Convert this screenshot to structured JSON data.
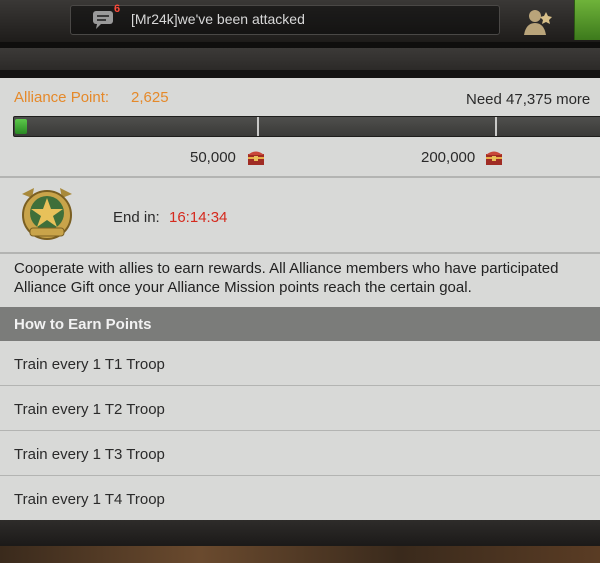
{
  "chat": {
    "unread_count": "6",
    "message": "[Mr24k]we've been attacked"
  },
  "alliance": {
    "points_label": "Alliance Point:",
    "points_value": "2,625",
    "need_text": "Need 47,375 more",
    "progress_fraction": 0.0525,
    "milestones": [
      "50,000",
      "200,000"
    ],
    "end_label": "End in:",
    "end_time": "16:14:34",
    "description_line1": "Cooperate with allies to earn rewards. All Alliance members who have participated",
    "description_line2": "Alliance Gift once your Alliance Mission points reach the certain goal."
  },
  "earn": {
    "title": "How to Earn Points",
    "tasks": [
      "Train every 1 T1 Troop",
      "Train every 1 T2 Troop",
      "Train every 1 T3 Troop",
      "Train every 1 T4 Troop"
    ]
  },
  "colors": {
    "accent_orange": "#e5892a",
    "timer_red": "#d52a1e",
    "progress_green": "#3aa830"
  },
  "icons": [
    "chat-icon",
    "alliance-member-icon",
    "treasure-chest-icon",
    "alliance-emblem-icon"
  ]
}
